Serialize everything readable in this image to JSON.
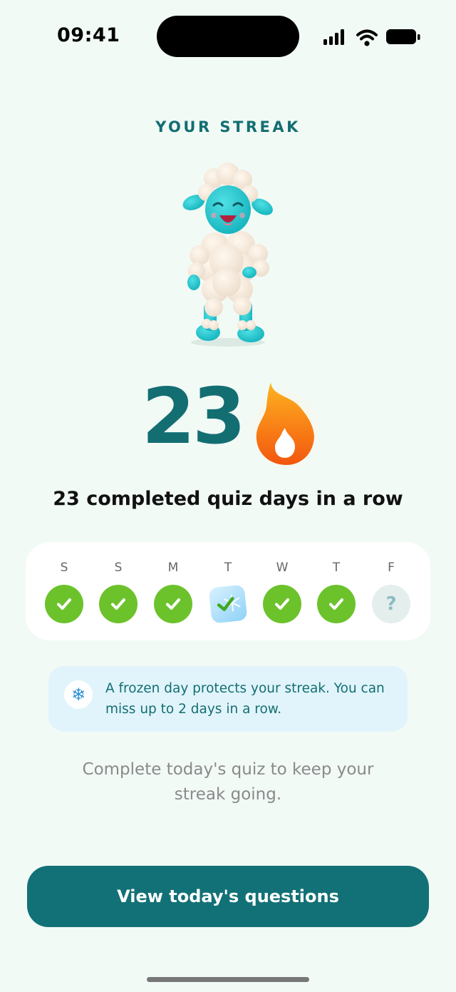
{
  "status_bar": {
    "time": "09:41"
  },
  "streak": {
    "title": "YOUR STREAK",
    "count": "23",
    "subtitle": "23 completed quiz days in a row"
  },
  "week": {
    "days": [
      {
        "label": "S",
        "status": "completed"
      },
      {
        "label": "S",
        "status": "completed"
      },
      {
        "label": "M",
        "status": "completed"
      },
      {
        "label": "T",
        "status": "frozen"
      },
      {
        "label": "W",
        "status": "completed"
      },
      {
        "label": "T",
        "status": "completed"
      },
      {
        "label": "F",
        "status": "pending",
        "mark": "?"
      }
    ]
  },
  "info": {
    "icon": "snowflake-icon",
    "text": "A frozen day protects your streak. You can miss up to 2 days in a row."
  },
  "helper_text": "Complete today's quiz to keep your streak going.",
  "cta": {
    "label": "View today's questions"
  },
  "colors": {
    "accent": "#136e72",
    "button": "#127176",
    "completed": "#6cc22b",
    "flame": "#f76b15",
    "background": "#f2faf6"
  }
}
